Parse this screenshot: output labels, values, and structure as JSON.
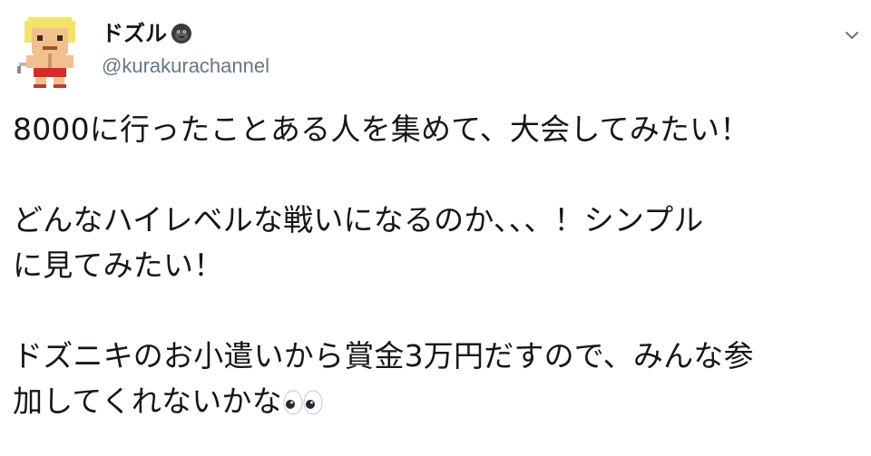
{
  "user": {
    "display_name": "ドズル",
    "handle": "@kurakurachannel",
    "avatar_icon": "pixel-character-avatar-icon",
    "badge_icon": "gorilla-face-icon"
  },
  "menu": {
    "icon": "chevron-down-icon"
  },
  "tweet": {
    "lines": [
      "8000に行ったことある人を集めて、大会してみたい！",
      "",
      "どんなハイレベルな戦いになるのか、、、！シンプル",
      "に見てみたい！",
      "",
      "ドズニキのお小遣いから賞金3万円だすので、みんな参",
      "加してくれないかな"
    ],
    "trailing_emoji": "eyes-emoji-icon"
  },
  "colors": {
    "text": "#14171a",
    "secondary_text": "#657786",
    "background": "#ffffff"
  }
}
